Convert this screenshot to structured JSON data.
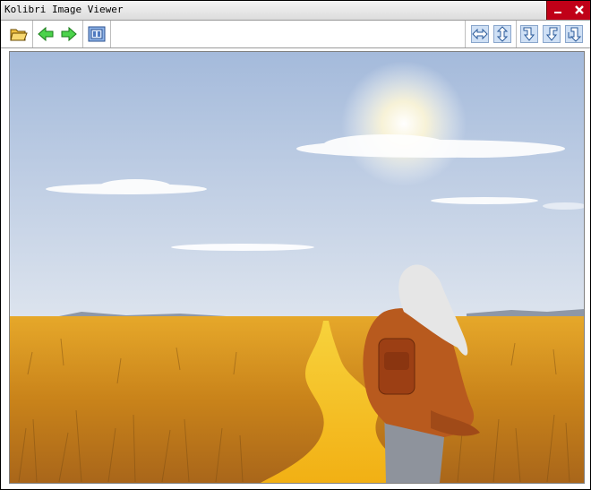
{
  "window": {
    "title": "Kolibri Image Viewer"
  },
  "titlebar_buttons": {
    "minimize_glyph": "▬",
    "close_glyph": "✕"
  },
  "toolbar": {
    "left_tools": [
      {
        "name": "open-folder-icon"
      },
      {
        "name": "previous-image-icon"
      },
      {
        "name": "next-image-icon"
      },
      {
        "name": "slideshow-icon"
      }
    ],
    "right_tools": [
      {
        "name": "flip-horizontal-icon"
      },
      {
        "name": "flip-vertical-icon"
      },
      {
        "name": "rotate-clockwise-icon"
      },
      {
        "name": "rotate-counterclockwise-icon"
      },
      {
        "name": "rotate-180-icon"
      }
    ]
  },
  "colors": {
    "close_button": "#c00018",
    "sky_top": "#a8bedb",
    "sky_bottom": "#d9e2ec",
    "field": "#d89b1e",
    "path": "#f2c21c",
    "coat": "#b85a1e",
    "hair": "#e8e8e8"
  }
}
